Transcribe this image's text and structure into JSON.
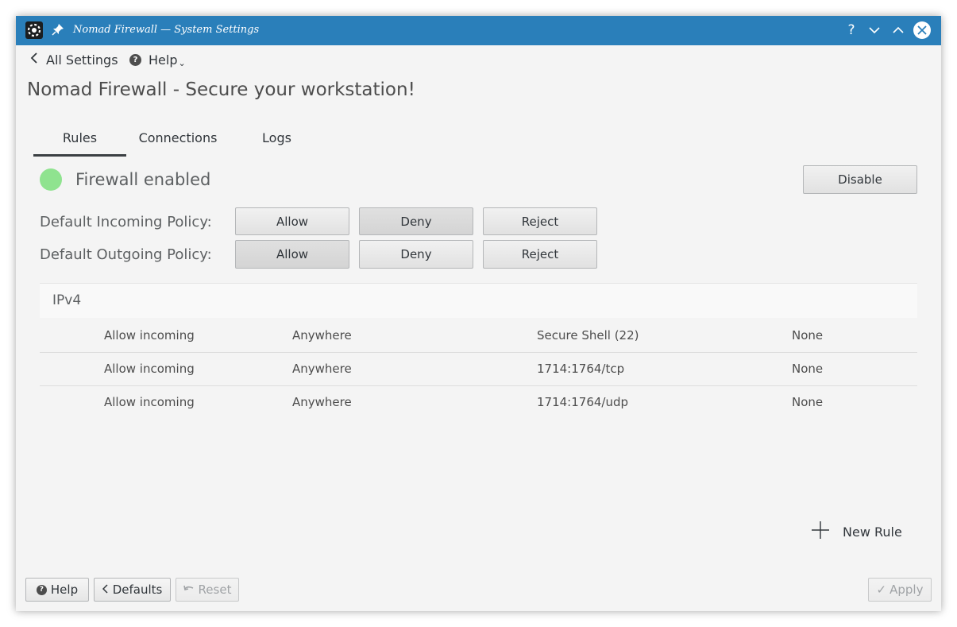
{
  "window": {
    "title": "Nomad Firewall — System Settings",
    "help_glyph": "?"
  },
  "nav": {
    "back_label": "All Settings",
    "help_label": "Help",
    "help_caret": "⌄"
  },
  "page": {
    "title": "Nomad Firewall - Secure your workstation!"
  },
  "tabs": [
    {
      "label": "Rules",
      "active": true
    },
    {
      "label": "Connections",
      "active": false
    },
    {
      "label": "Logs",
      "active": false
    }
  ],
  "status": {
    "text": "Firewall enabled",
    "toggle_label": "Disable",
    "led_color": "#8fe38f"
  },
  "policies": {
    "incoming": {
      "label": "Default Incoming Policy:",
      "options": [
        "Allow",
        "Deny",
        "Reject"
      ],
      "selected": "Deny"
    },
    "outgoing": {
      "label": "Default Outgoing Policy:",
      "options": [
        "Allow",
        "Deny",
        "Reject"
      ],
      "selected": "Allow"
    }
  },
  "rules": {
    "section_label": "IPv4",
    "rows": [
      {
        "action": "Allow incoming",
        "from": "Anywhere",
        "to": "Secure Shell (22)",
        "logging": "None"
      },
      {
        "action": "Allow incoming",
        "from": "Anywhere",
        "to": "1714:1764/tcp",
        "logging": "None"
      },
      {
        "action": "Allow incoming",
        "from": "Anywhere",
        "to": "1714:1764/udp",
        "logging": "None"
      }
    ],
    "new_rule_label": "New Rule"
  },
  "footer": {
    "help_label": "Help",
    "defaults_label": "Defaults",
    "reset_label": "Reset",
    "apply_label": "Apply",
    "apply_glyph": "✓"
  },
  "colors": {
    "titlebar": "#2a7fba",
    "background": "#f4f4f4",
    "status_led": "#8fe38f"
  },
  "icons": [
    "settings-app-icon",
    "pin-icon",
    "help-icon",
    "minimize-icon",
    "maximize-icon",
    "close-icon",
    "chevron-left-icon",
    "plus-icon",
    "undo-icon",
    "checkmark-icon"
  ]
}
